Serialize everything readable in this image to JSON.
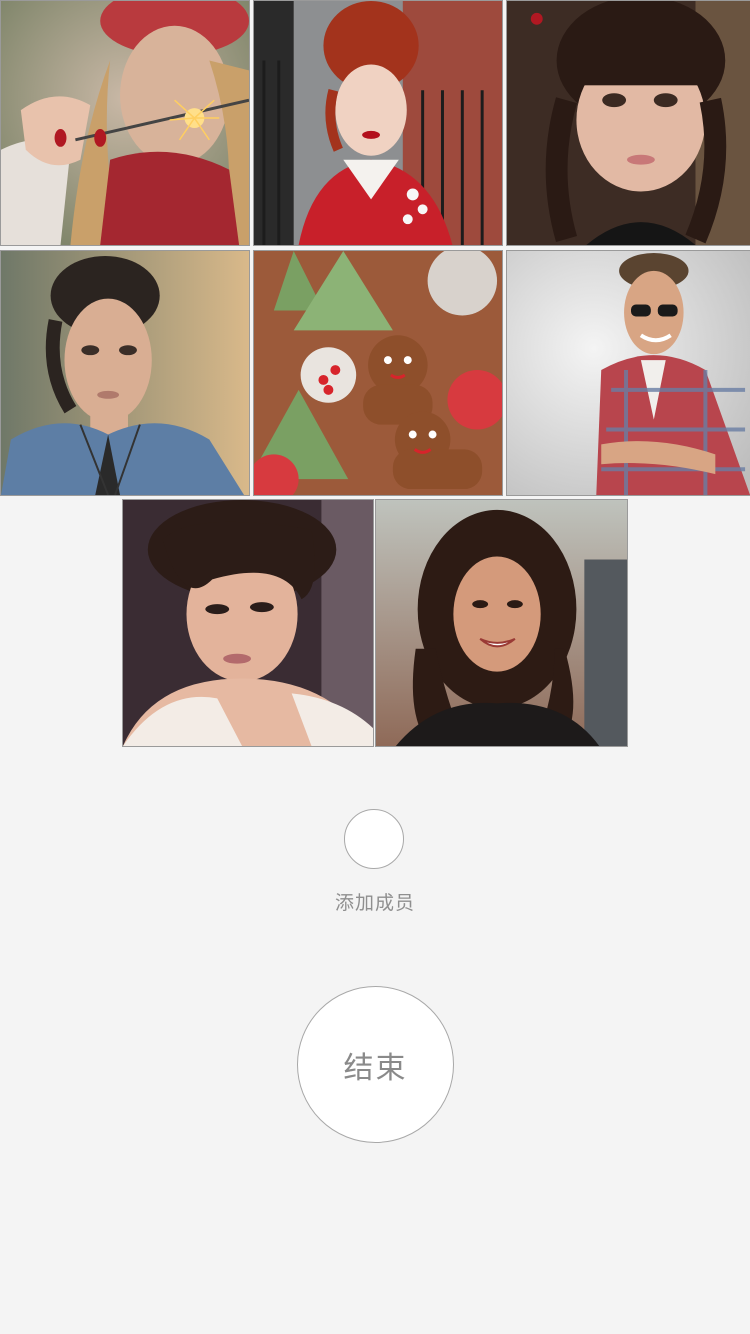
{
  "members": [
    {
      "photo": "woman-with-sparkler-photo"
    },
    {
      "photo": "red-haired-woman-photo"
    },
    {
      "photo": "girl-with-braids-photo"
    },
    {
      "photo": "woman-denim-jacket-photo"
    },
    {
      "photo": "gingerbread-cookies-photo"
    },
    {
      "photo": "man-sunglasses-plaid-photo"
    },
    {
      "photo": "short-haired-woman-photo"
    },
    {
      "photo": "smiling-woman-photo"
    }
  ],
  "add_member": {
    "label": "添加成员",
    "icon": "add-member-circle"
  },
  "end_button": {
    "label": "结束"
  },
  "colors": {
    "background": "#f4f4f4",
    "button_fill": "#ffffff",
    "button_border": "#a8a8a8",
    "label_text": "#8f8f8f"
  }
}
